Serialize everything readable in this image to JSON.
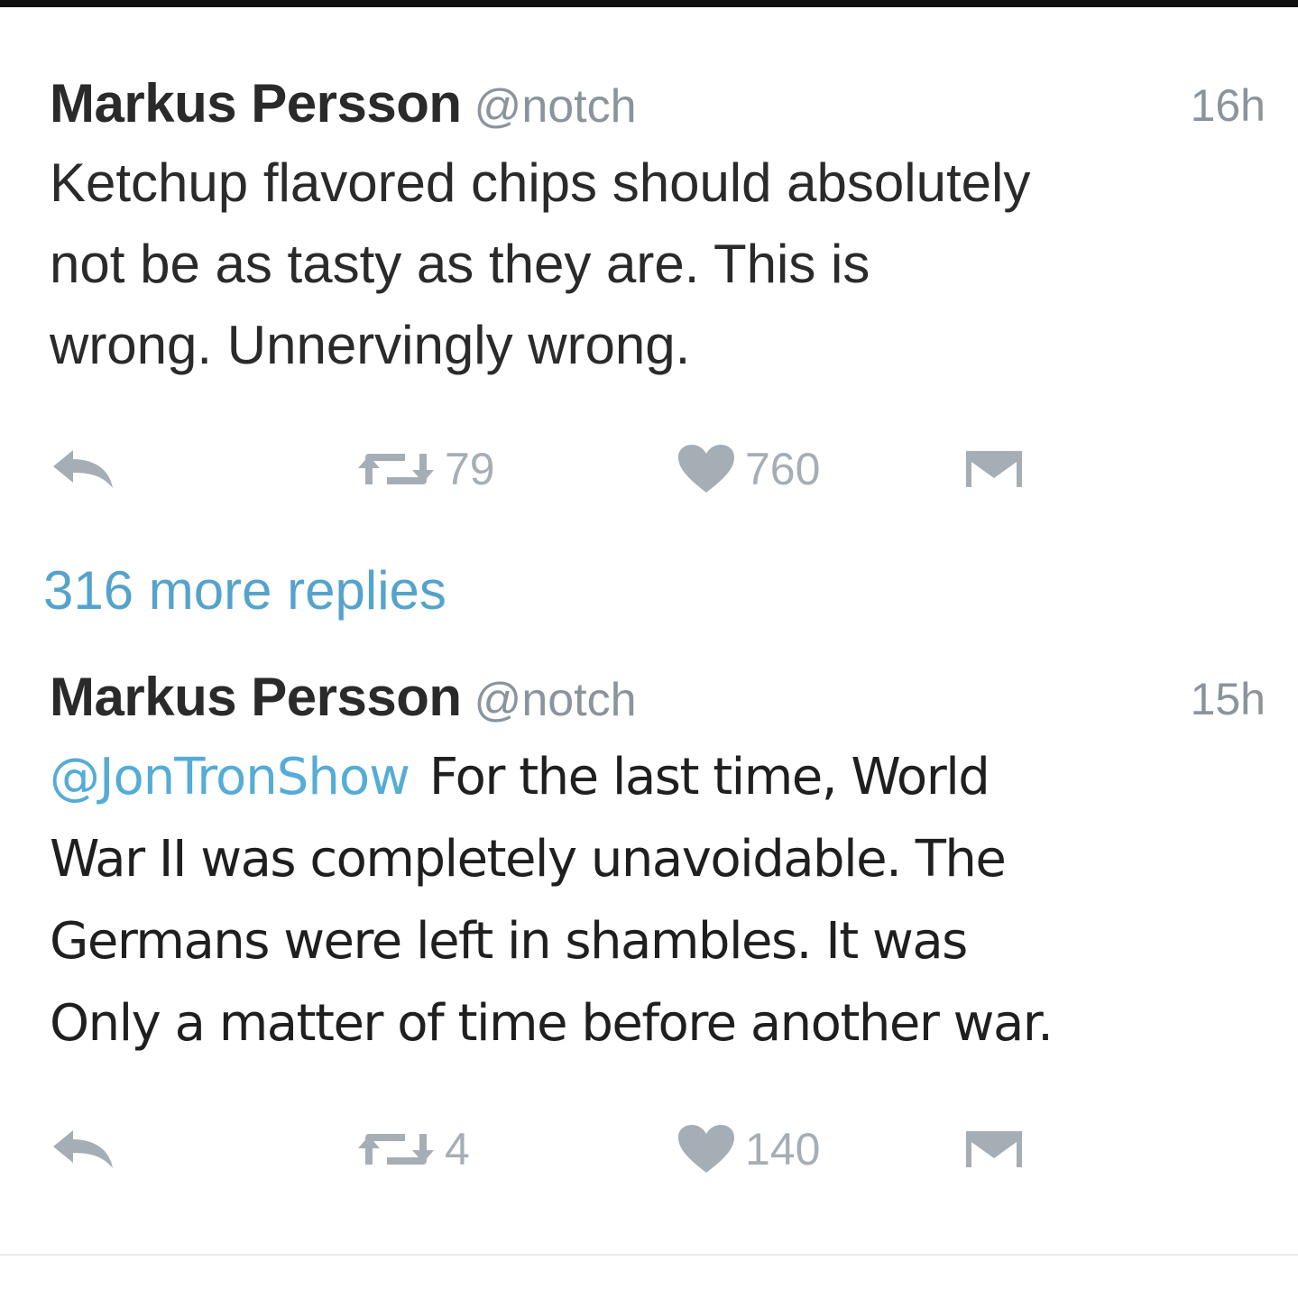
{
  "tweets": [
    {
      "author_name": "Markus Persson",
      "author_handle": "@notch",
      "time": "16h",
      "mention": "",
      "text_lines": [
        "Ketchup flavored chips should absolutely",
        "not be as tasty as they are. This is",
        "wrong. Unnervingly wrong."
      ],
      "retweet_count": "79",
      "like_count": "760"
    },
    {
      "author_name": "Markus Persson",
      "author_handle": "@notch",
      "time": "15h",
      "mention": "@JonTronShow",
      "text_lines": [
        "For the last time, World",
        "War II was completely unavoidable. The",
        "Germans were left in shambles. It was",
        "Only a matter of time before another war."
      ],
      "retweet_count": "4",
      "like_count": "140"
    }
  ],
  "more_replies": "316 more replies",
  "icons": {
    "reply": "reply-icon",
    "retweet": "retweet-icon",
    "like": "heart-icon",
    "dm": "envelope-icon"
  },
  "colors": {
    "text": "#2a2a2a",
    "handle": "#8a949c",
    "icon": "#a6aeb5",
    "link": "#55acd6"
  }
}
